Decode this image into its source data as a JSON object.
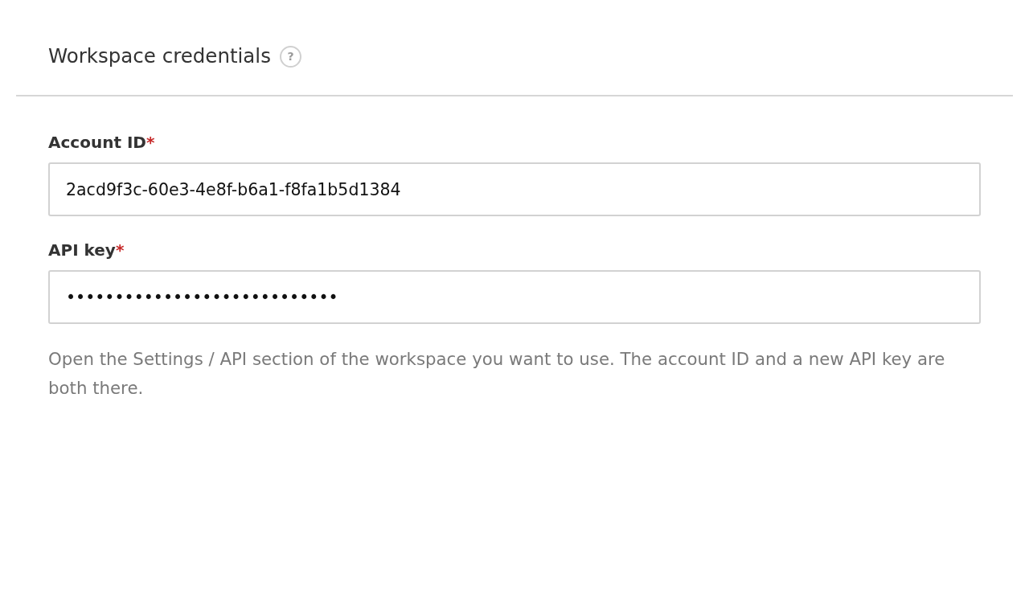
{
  "header": {
    "title": "Workspace credentials",
    "help_icon": "?"
  },
  "fields": [
    {
      "label": "Account ID",
      "required_mark": "*",
      "value": "2acd9f3c-60e3-4e8f-b6a1-f8fa1b5d1384"
    },
    {
      "label": "API key",
      "required_mark": "*",
      "value": "••••••••••••••••••••••••••••"
    }
  ],
  "help_text": "Open the Settings / API section of the workspace you want to use. The account ID and a new API key are both there."
}
